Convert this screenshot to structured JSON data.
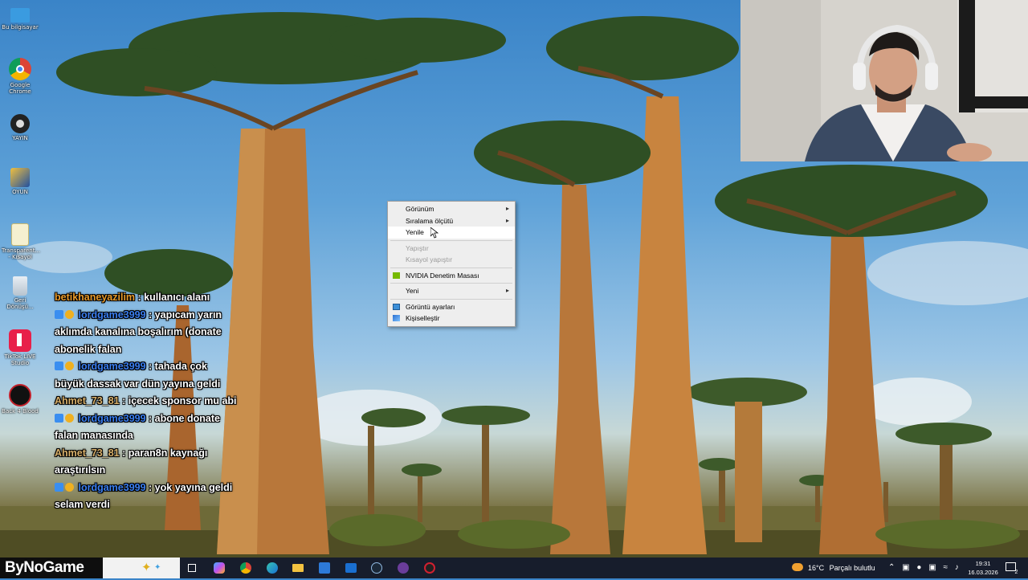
{
  "desktop_icons": [
    {
      "label": "Bu bilgisayar",
      "icon": "computer-icon"
    },
    {
      "label": "Google Chrome",
      "icon": "chrome-icon"
    },
    {
      "label": "YAYIN",
      "icon": "obs-icon"
    },
    {
      "label": "OYUN",
      "icon": "game-icon"
    },
    {
      "label": "Transparent... - Kısayol",
      "icon": "file-shortcut-icon"
    },
    {
      "label": "Geri Dönüşü...",
      "icon": "recycle-bin-icon"
    },
    {
      "label": "TikTok LIVE Studio",
      "icon": "tiktok-icon"
    },
    {
      "label": "Back 4 Blood",
      "icon": "back4blood-icon"
    }
  ],
  "chat": [
    {
      "user": "betikhaneyazilim",
      "text": ": kullanıcı alanı"
    },
    {
      "user": "lordgame3999",
      "text": ": yapıcam yarın aklımda kanalına boşalırım (donate abonelik falan"
    },
    {
      "user": "lordgame3999",
      "text": ": tahada çok büyük dassak var dün yayına geldi"
    },
    {
      "user": "Ahmet_73_81",
      "text": ": içecek sponsor mu abi"
    },
    {
      "user": "lordgame3999",
      "text": ": abone donate falan manasında"
    },
    {
      "user": "Ahmet_73_81",
      "text": ": paran8n kaynağı araştırılsın"
    },
    {
      "user": "lordgame3999",
      "text": ": yok yayına geldi selam verdi"
    }
  ],
  "context_menu": {
    "items": [
      {
        "label": "Görünüm",
        "submenu": true
      },
      {
        "label": "Sıralama ölçütü",
        "submenu": true
      },
      {
        "label": "Yenile"
      },
      {
        "label": "Yapıştır",
        "disabled": true
      },
      {
        "label": "Kısayol yapıştır",
        "disabled": true
      },
      {
        "label": "NVIDIA Denetim Masası",
        "icon": "nvidia-icon"
      },
      {
        "label": "Yeni",
        "submenu": true
      },
      {
        "label": "Görüntü ayarları",
        "icon": "display-icon"
      },
      {
        "label": "Kişiselleştir",
        "icon": "personalize-icon"
      }
    ],
    "hovered": "Yenile"
  },
  "taskbar": {
    "brand": "ByNoGame",
    "weather_temp": "16°C",
    "weather_text": "Parçalı bulutlu",
    "time": "19:31",
    "date": "16.03.2026",
    "notifications": "2"
  },
  "colors": {
    "taskbar_bg": "#171d2c",
    "menu_bg": "#eeeeee",
    "chat_user_blue": "#3a7ef0",
    "chat_user_orange": "#e89a2a"
  }
}
